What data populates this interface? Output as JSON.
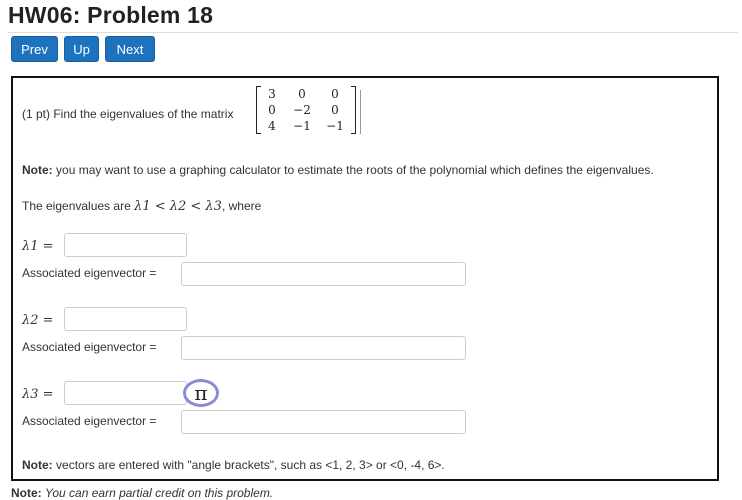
{
  "page": {
    "title": "HW06: Problem 18"
  },
  "nav": {
    "prev": "Prev",
    "up": "Up",
    "next": "Next"
  },
  "problem": {
    "points": "(1 pt) Find the eigenvalues of the matrix",
    "matrix": [
      [
        "3",
        "0",
        "0"
      ],
      [
        "0",
        "−2",
        "0"
      ],
      [
        "4",
        "−1",
        "−1"
      ]
    ],
    "note_label": "Note:",
    "note_text": "you may want to use a graphing calculator to estimate the roots of the polynomial which defines the eigenvalues.",
    "eig_intro": "The eigenvalues are",
    "eig_order": "λ1 < λ2 < λ3",
    "eig_where": ", where",
    "lambda_labels": [
      "λ1 =",
      "λ2 =",
      "λ3 ="
    ],
    "eigenvector_label": "Associated eigenvector =",
    "answers": {
      "lambda1": "",
      "vector1": "",
      "lambda2": "",
      "vector2": "",
      "lambda3": "",
      "vector3": ""
    },
    "pi_button": "π",
    "vectors_note_label": "Note:",
    "vectors_note_text": "vectors are entered with \"angle brackets\", such as <1, 2, 3> or <0, -4, 6>."
  },
  "footer": {
    "note_label": "Note:",
    "note_text": "You can earn partial credit on this problem."
  }
}
